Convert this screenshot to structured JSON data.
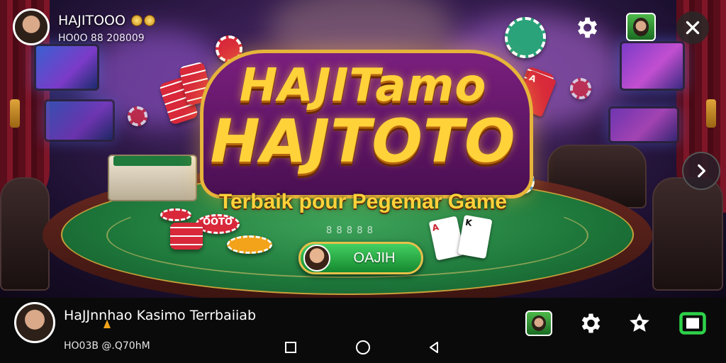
{
  "player": {
    "name": "HAJITOOO",
    "id_line": "HO0O 88 208009",
    "coin_icon": "coin-icon"
  },
  "logo": {
    "line1": "HAJITamo",
    "line2": "HAJTOTO",
    "tagline": "Terbaik pour Pegemar Game"
  },
  "cta": {
    "label": "OAJIH",
    "icon": "avatar-icon"
  },
  "scene": {
    "chip_text": "OOTO",
    "felt_text": "8 8 8 8 8"
  },
  "bottom_bar": {
    "title": "HaJJnnhao Kasimo Terrbaiiab",
    "subtitle": "HO03B  @.Q70hM"
  },
  "icons": {
    "settings": "gear-icon",
    "close": "close-icon",
    "next": "chevron-right-icon",
    "favorite": "star-badge-icon",
    "screen": "screen-icon",
    "nav_recent": "square-nav-icon",
    "nav_home": "circle-nav-icon",
    "nav_back": "triangle-back-icon"
  },
  "colors": {
    "accent_gold": "#ffd23a",
    "cta_green": "#2fb34a",
    "felt_green": "#1f7a3c",
    "bar_bg": "#0a0a0a"
  }
}
